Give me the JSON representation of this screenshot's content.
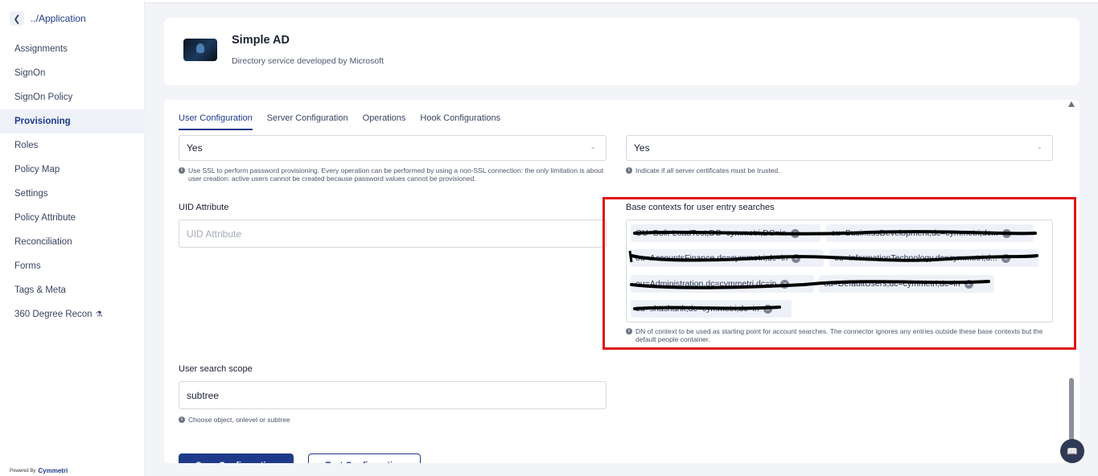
{
  "sidebar": {
    "back_label": "../Application",
    "items": [
      {
        "label": "Assignments"
      },
      {
        "label": "SignOn"
      },
      {
        "label": "SignOn Policy"
      },
      {
        "label": "Provisioning",
        "active": true
      },
      {
        "label": "Roles"
      },
      {
        "label": "Policy Map"
      },
      {
        "label": "Settings"
      },
      {
        "label": "Policy Attribute"
      },
      {
        "label": "Reconciliation"
      },
      {
        "label": "Forms"
      },
      {
        "label": "Tags & Meta"
      },
      {
        "label": "360 Degree Recon",
        "icon": "flask-icon"
      }
    ],
    "powered_by": "Powered By",
    "brand": "Cymmetri"
  },
  "header": {
    "title": "Simple AD",
    "subtitle": "Directory service developed by Microsoft"
  },
  "tabs": [
    {
      "label": "User Configuration",
      "active": true
    },
    {
      "label": "Server Configuration"
    },
    {
      "label": "Operations"
    },
    {
      "label": "Hook Configurations"
    }
  ],
  "form": {
    "ssl_select": {
      "value": "Yes",
      "hint": "Use SSL to perform password provisioning. Every operation can be performed by using a non-SSL connection: the only limitation is about user creation: active users cannot be created because password values cannot be provisioned."
    },
    "trust_select": {
      "value": "Yes",
      "hint": "Indicate if all server certificates must be trusted."
    },
    "uid": {
      "label": "UID Attribute",
      "placeholder": "UID Attribute"
    },
    "base_contexts": {
      "label": "Base contexts for user entry searches",
      "chips": [
        "OU=Bulk-LoadTest,DC=cymmetri,DC=in",
        "ou=BusinessDevelopment,dc=cymmetri,dc...",
        "ou=AccountsFinance,dc=cymmetri,dc=in",
        "ou=InformationTechnology,dc=cymmetri,d...",
        "ou=Administration,dc=cymmetri,dc=in",
        "ou=DefaultUsers,dc=cymmetri,dc=in",
        "ou=shashank,dc=cymmetri,dc=in"
      ],
      "hint": "DN of context to be used as starting point for account searches. The connector ignores any entries outside these base contexts but the default people container."
    },
    "search_scope": {
      "label": "User search scope",
      "value": "subtree",
      "hint": "Choose object, onlevel or subtree"
    }
  },
  "actions": {
    "save_label": "Save Configuration",
    "test_label": "Test Configuration"
  },
  "colors": {
    "accent": "#1e3a8a",
    "highlight": "#e01616"
  }
}
